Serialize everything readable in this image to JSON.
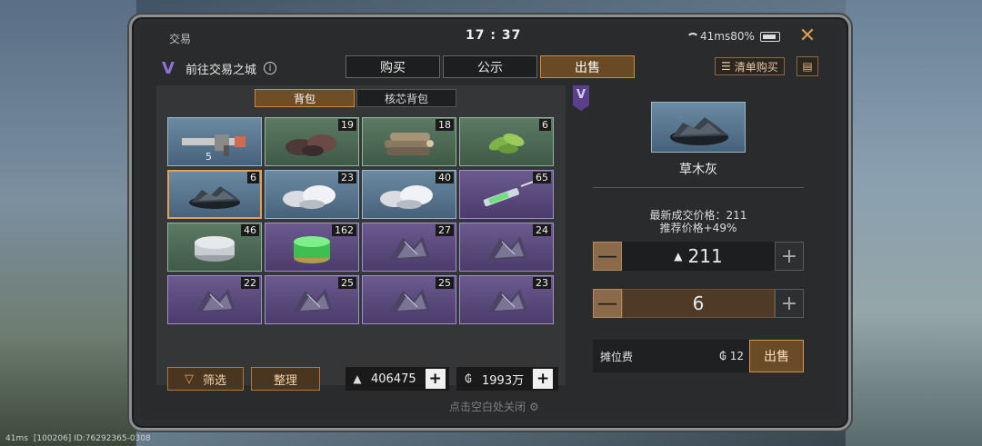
{
  "topbar": {
    "title": "交易",
    "clock": "17 : 37",
    "status_text": "41ms80%"
  },
  "header": {
    "city_link": "前往交易之城",
    "tabs": [
      {
        "label": "购买"
      },
      {
        "label": "公示"
      },
      {
        "label": "出售"
      }
    ],
    "active_tab": "出售",
    "list_buy": "清单购买"
  },
  "inventory": {
    "subtabs": [
      {
        "label": "背包"
      },
      {
        "label": "核芯背包"
      }
    ],
    "active_subtab": "背包",
    "items": [
      {
        "qty": "5",
        "color": "blue",
        "icon": "weapon-icon"
      },
      {
        "qty": "19",
        "color": "green",
        "icon": "ore-icon"
      },
      {
        "qty": "18",
        "color": "green",
        "icon": "logs-icon"
      },
      {
        "qty": "6",
        "color": "green",
        "icon": "leaf-icon"
      },
      {
        "qty": "6",
        "color": "blue",
        "icon": "ash-icon",
        "selected": true
      },
      {
        "qty": "23",
        "color": "blue",
        "icon": "silver-ore-icon"
      },
      {
        "qty": "40",
        "color": "blue",
        "icon": "silver-ore-icon"
      },
      {
        "qty": "65",
        "color": "purple",
        "icon": "syringe-icon"
      },
      {
        "qty": "46",
        "color": "green",
        "icon": "coin-stack-icon"
      },
      {
        "qty": "162",
        "color": "purple",
        "icon": "gel-jar-icon"
      },
      {
        "qty": "27",
        "color": "purple",
        "icon": "crystal-pile-icon"
      },
      {
        "qty": "24",
        "color": "purple",
        "icon": "crystal-pile-icon"
      },
      {
        "qty": "22",
        "color": "purple",
        "icon": "crystal-pile-icon"
      },
      {
        "qty": "25",
        "color": "purple",
        "icon": "crystal-pile-icon"
      },
      {
        "qty": "25",
        "color": "purple",
        "icon": "crystal-pile-icon"
      },
      {
        "qty": "23",
        "color": "purple",
        "icon": "crystal-pile-icon"
      }
    ],
    "filter_label": "筛选",
    "sort_label": "整理",
    "currency_a": "406475",
    "currency_b": "1993万"
  },
  "sell": {
    "item_name": "草木灰",
    "latest_price": "最新成交价格：211",
    "recommended": "推荐价格+49%",
    "price_value": "211",
    "quantity_value": "6",
    "fee_label": "摊位费",
    "fee_value": "12",
    "sell_label": "出售"
  },
  "close_hint": "点击空白处关闭",
  "footer": {
    "ping": "41ms",
    "session": "[100206] ID:76292365-0308"
  }
}
